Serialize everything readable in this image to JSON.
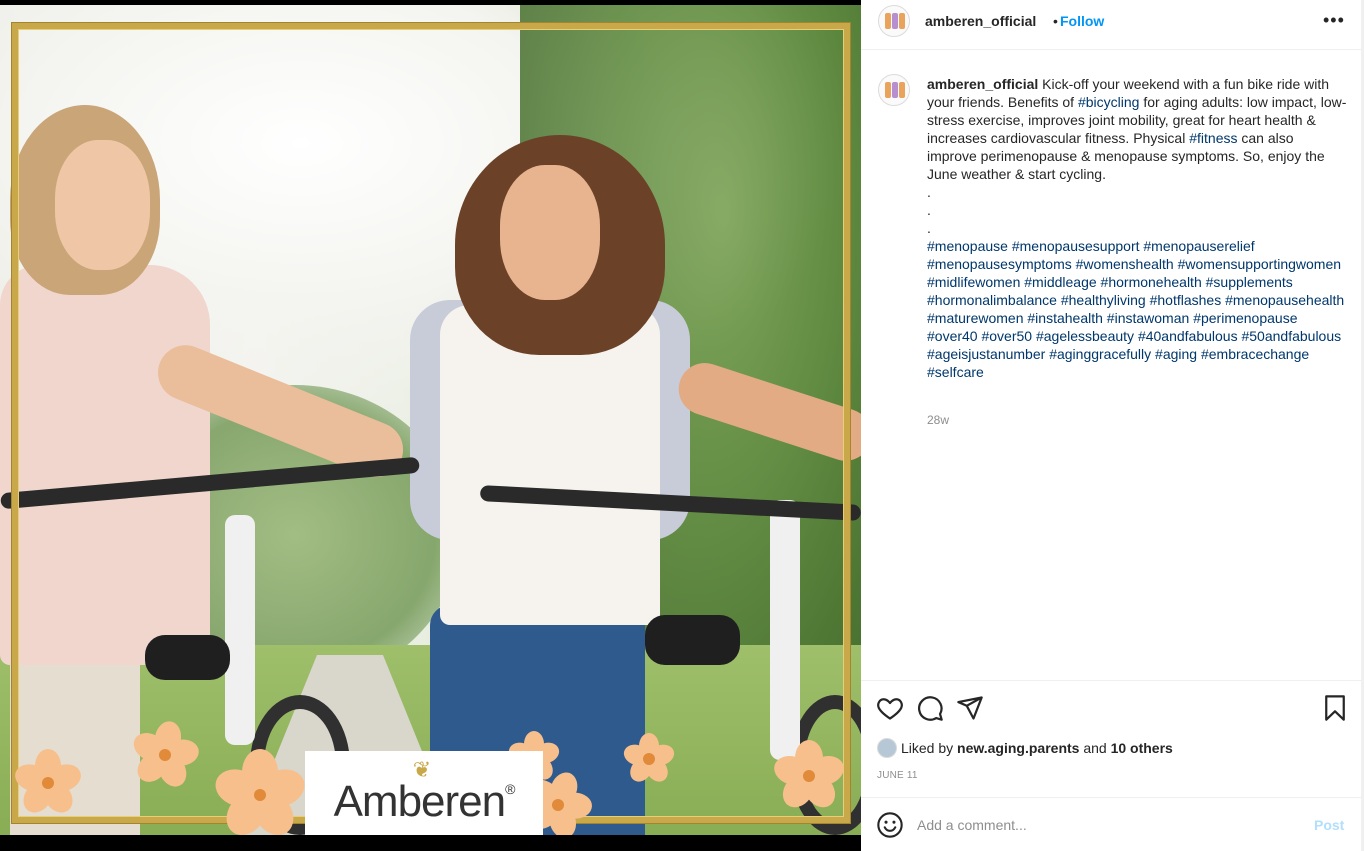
{
  "post": {
    "image_logo_text": "Amberen",
    "image_logo_reg": "®"
  },
  "header": {
    "username": "amberen_official",
    "separator": "•",
    "follow_label": "Follow",
    "more_icon": "more-horizontal-icon"
  },
  "caption": {
    "username": "amberen_official",
    "text_1": " Kick-off your weekend with a fun bike ride with your friends. Benefits of ",
    "tag_bicycling": "#bicycling",
    "text_2": " for aging adults: low impact, low-stress exercise, improves joint mobility, great for heart health & increases cardiovascular fitness. Physical ",
    "tag_fitness": "#fitness",
    "text_3": " can also improve perimenopause & menopause symptoms. So, enjoy the June weather & start cycling.",
    "dots": [
      ".",
      ".",
      "."
    ],
    "hashtags": [
      "#menopause",
      "#menopausesupport",
      "#menopauserelief",
      "#menopausesymptoms",
      "#womenshealth",
      "#womensupportingwomen",
      "#midlifewomen",
      "#middleage",
      "#hormonehealth",
      "#supplements",
      "#hormonalimbalance",
      "#healthyliving",
      "#hotflashes",
      "#menopausehealth",
      "#maturewomen",
      "#instahealth",
      "#instawoman",
      "#perimenopause",
      "#over40",
      "#over50",
      "#agelessbeauty",
      "#40andfabulous",
      "#50andfabulous",
      "#ageisjustanumber",
      "#aginggracefully",
      "#aging",
      "#embracechange",
      "#selfcare"
    ],
    "age": "28w"
  },
  "actions": {
    "like_icon": "heart-icon",
    "comment_icon": "comment-icon",
    "share_icon": "send-icon",
    "save_icon": "bookmark-icon"
  },
  "likes": {
    "prefix": "Liked by ",
    "user": "new.aging.parents",
    "middle": " and ",
    "others": "10 others"
  },
  "date": "JUNE 11",
  "comment": {
    "placeholder": "Add a comment...",
    "post_label": "Post",
    "emoji_icon": "emoji-icon"
  },
  "colors": {
    "link_blue": "#0095f6",
    "hashtag": "#00376b",
    "post_disabled": "#b2dffc",
    "frame_gold": "#c9a84a"
  }
}
